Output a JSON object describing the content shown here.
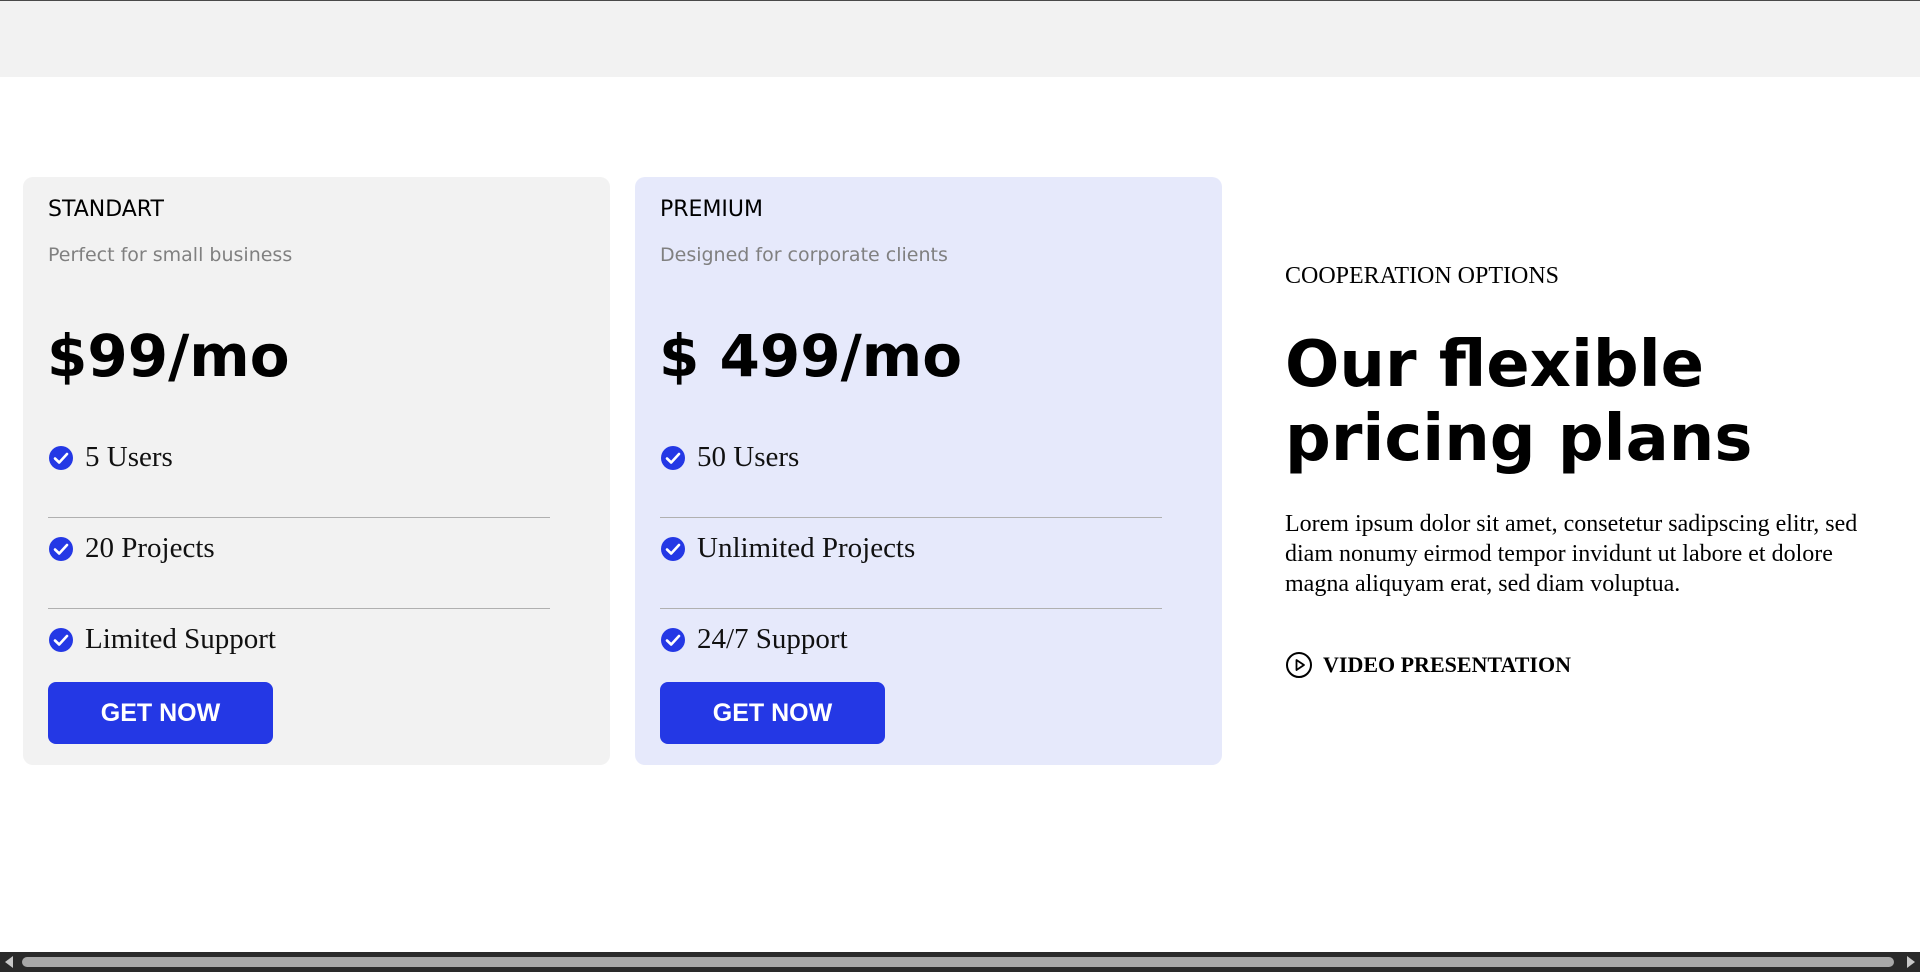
{
  "plans": [
    {
      "name": "STANDART",
      "description": "Perfect for small business",
      "price": "$99/mo",
      "features": [
        "5 Users",
        "20 Projects",
        "Limited Support"
      ],
      "cta_label": "GET NOW"
    },
    {
      "name": "PREMIUM",
      "description": "Designed for corporate clients",
      "price": "$ 499/mo",
      "features": [
        "50 Users",
        "Unlimited Projects",
        "24/7 Support"
      ],
      "cta_label": "GET NOW"
    }
  ],
  "side": {
    "eyebrow": "COOPERATION OPTIONS",
    "headline": "Our flexible pricing plans",
    "body": "Lorem ipsum dolor sit amet, consetetur sadipscing elitr, sed diam nonumy eirmod tempor invidunt ut labore et dolore magna aliquyam erat, sed diam voluptua.",
    "video_link_label": "VIDEO PRESENTATION",
    "video_icon": "play-circle-icon"
  },
  "colors": {
    "accent": "#2438e5",
    "standard_card_bg": "#f2f2f2",
    "premium_card_bg": "#e6e9fb",
    "muted_text": "#808080"
  }
}
